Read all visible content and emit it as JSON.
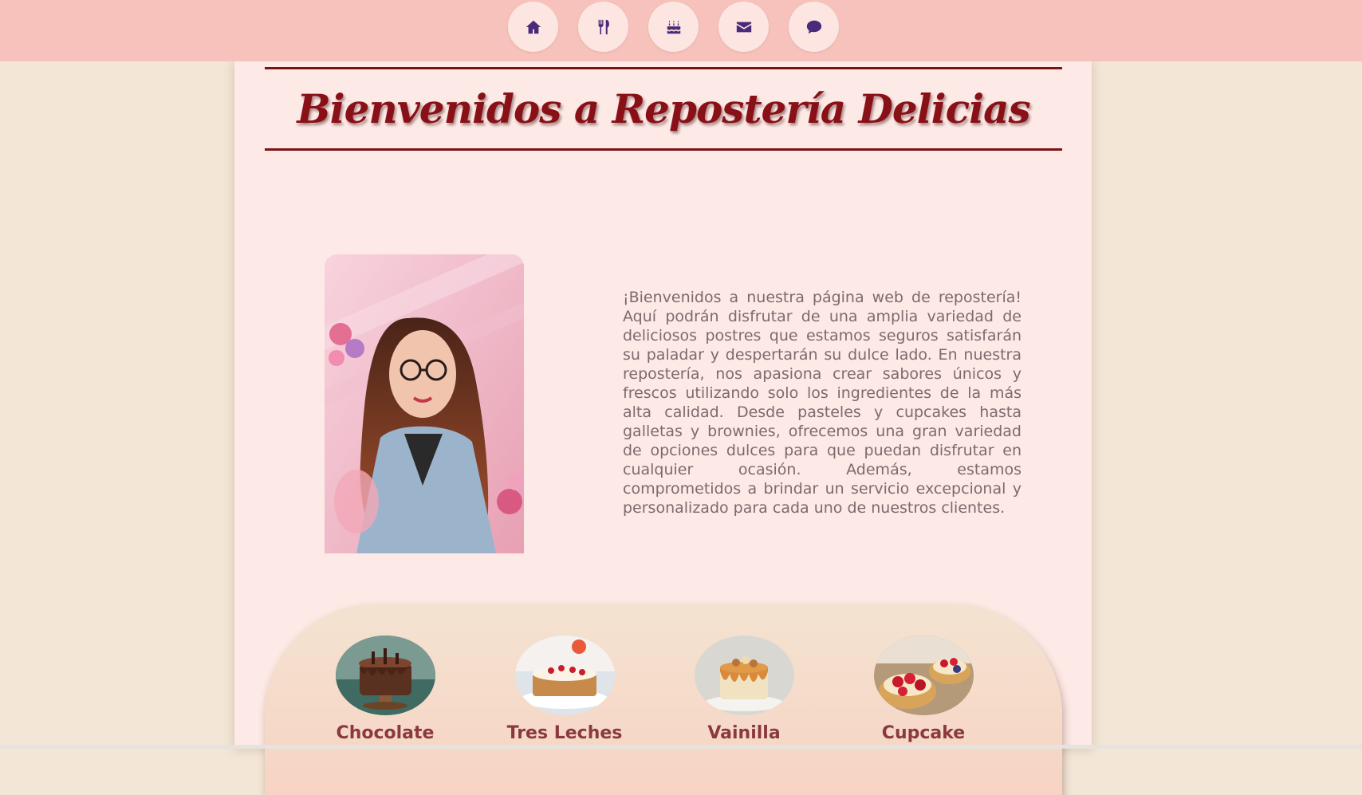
{
  "nav": [
    {
      "icon": "home-icon",
      "label": "Inicio"
    },
    {
      "icon": "cutlery-icon",
      "label": "Menú"
    },
    {
      "icon": "cake-icon",
      "label": "Pasteles"
    },
    {
      "icon": "envelope-icon",
      "label": "Contacto"
    },
    {
      "icon": "comment-icon",
      "label": "Comentarios"
    }
  ],
  "header": {
    "title": "Bienvenidos a Repostería Delicias"
  },
  "intro": {
    "text": "¡Bienvenidos a nuestra página web de repostería! Aquí podrán disfrutar de una amplia variedad de deliciosos postres que estamos seguros satisfarán su paladar y despertarán su dulce lado. En nuestra repostería, nos apasiona crear sabores únicos y frescos utilizando solo los ingredientes de la más alta calidad. Desde pasteles y cupcakes hasta galletas y brownies, ofrecemos una gran variedad de opciones dulces para que puedan disfrutar en cualquier ocasión. Además, estamos comprometidos a brindar un servicio excepcional y personalizado para cada uno de nuestros clientes."
  },
  "flavors": [
    {
      "label": "Chocolate"
    },
    {
      "label": "Tres Leches"
    },
    {
      "label": "Vainilla"
    },
    {
      "label": "Cupcake"
    }
  ],
  "colors": {
    "topbar": "#f7c2bb",
    "title": "#8a1018",
    "nav_icon": "#4a2a7a",
    "flavor_label": "#8a3a3e"
  }
}
